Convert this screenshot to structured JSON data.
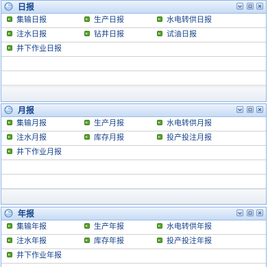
{
  "panels": [
    {
      "title": "日报",
      "items": [
        [
          "集输日报",
          "生产日报",
          "水电转供日报"
        ],
        [
          "注水日报",
          "钻井日报",
          "试油日报"
        ],
        [
          "井下作业日报"
        ]
      ]
    },
    {
      "title": "月报",
      "items": [
        [
          "集输月报",
          "生产月报",
          "水电转供月报"
        ],
        [
          "注水月报",
          "库存月报",
          "投产投注月报"
        ],
        [
          "井下作业月报"
        ]
      ]
    },
    {
      "title": "年报",
      "items": [
        [
          "集输年报",
          "生产年报",
          "水电转供年报"
        ],
        [
          "注水年报",
          "库存年报",
          "投产投注年报"
        ],
        [
          "井下作业年报"
        ]
      ]
    }
  ],
  "icons": {
    "panel_icon": "globe-icon",
    "tool_collapse": "chevron-down-icon",
    "tool_restore": "restore-icon",
    "tool_close": "close-icon",
    "bullet": "green-arrow-bullet-icon"
  },
  "colors": {
    "header_text": "#15428b",
    "border": "#8db2e3",
    "bullet": "#5aa52c"
  }
}
